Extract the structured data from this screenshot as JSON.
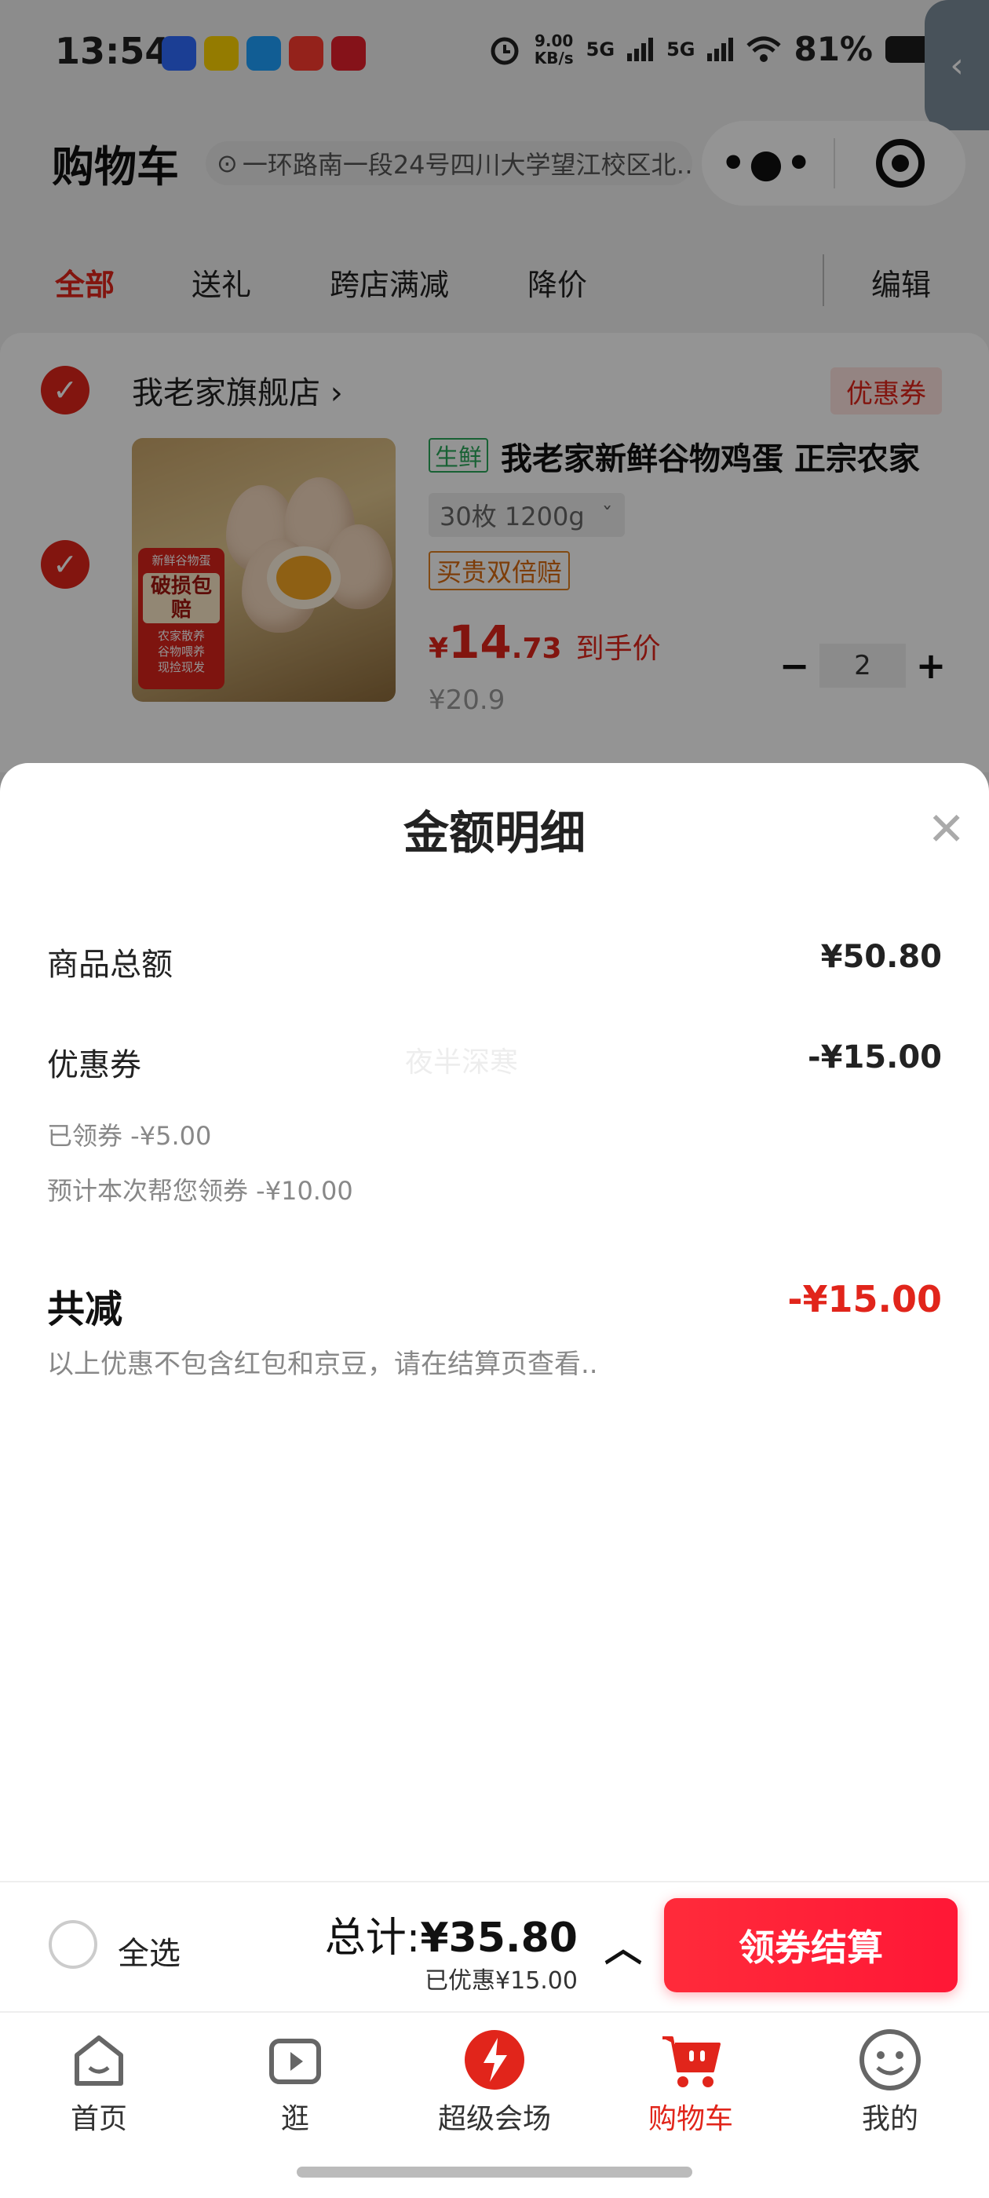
{
  "status_bar": {
    "time": "13:54",
    "net_speed_value": "9.00",
    "net_speed_unit": "KB/s",
    "signal_1": "5G",
    "signal_2": "5G",
    "battery": "81%"
  },
  "header": {
    "title": "购物车",
    "address": "一环路南一段24号四川大学望江校区北…"
  },
  "filter_tabs": [
    {
      "label": "全部",
      "active": true
    },
    {
      "label": "送礼"
    },
    {
      "label": "跨店满减"
    },
    {
      "label": "降价"
    }
  ],
  "edit_label": "编辑",
  "store": {
    "name": "我老家旗舰店",
    "coupon_tag": "优惠券",
    "product": {
      "fresh_tag": "生鲜",
      "title": "我老家新鲜谷物鸡蛋 正宗农家",
      "spec": "30枚 1200g",
      "guarantee_tag": "买贵双倍赔",
      "price_currency": "¥",
      "price_int": "14",
      "price_dec": ".73",
      "price_label": "到手价",
      "price_original": "¥20.9",
      "quantity": "2",
      "image_badge": {
        "top": "新鲜谷物蛋",
        "big": "破损包赔",
        "lines": [
          "农家散养",
          "谷物喂养",
          "现捡现发"
        ]
      }
    }
  },
  "sheet": {
    "title": "金额明细",
    "goods_total_label": "商品总额",
    "goods_total_value": "¥50.80",
    "coupon_label": "优惠券",
    "coupon_value": "-¥15.00",
    "coupon_claimed": "已领券 -¥5.00",
    "coupon_estimated": "预计本次帮您领券 -¥10.00",
    "total_discount_label": "共减",
    "total_discount_value": "-¥15.00",
    "note": "以上优惠不包含红包和京豆，请在结算页查看..",
    "watermark": "夜半深寒"
  },
  "checkout": {
    "select_all": "全选",
    "total_prefix": "总计:",
    "total_amount": "¥35.80",
    "saved": "已优惠¥15.00",
    "button": "领券结算"
  },
  "tabbar": [
    {
      "label": "首页",
      "icon": "home-icon"
    },
    {
      "label": "逛",
      "icon": "video-icon"
    },
    {
      "label": "超级会场",
      "icon": "super-venue-icon"
    },
    {
      "label": "购物车",
      "icon": "cart-icon",
      "active": true
    },
    {
      "label": "我的",
      "icon": "profile-icon"
    }
  ],
  "colors": {
    "accent": "#e1251b",
    "fresh": "#2aa85a",
    "guarantee": "#d86a10"
  }
}
